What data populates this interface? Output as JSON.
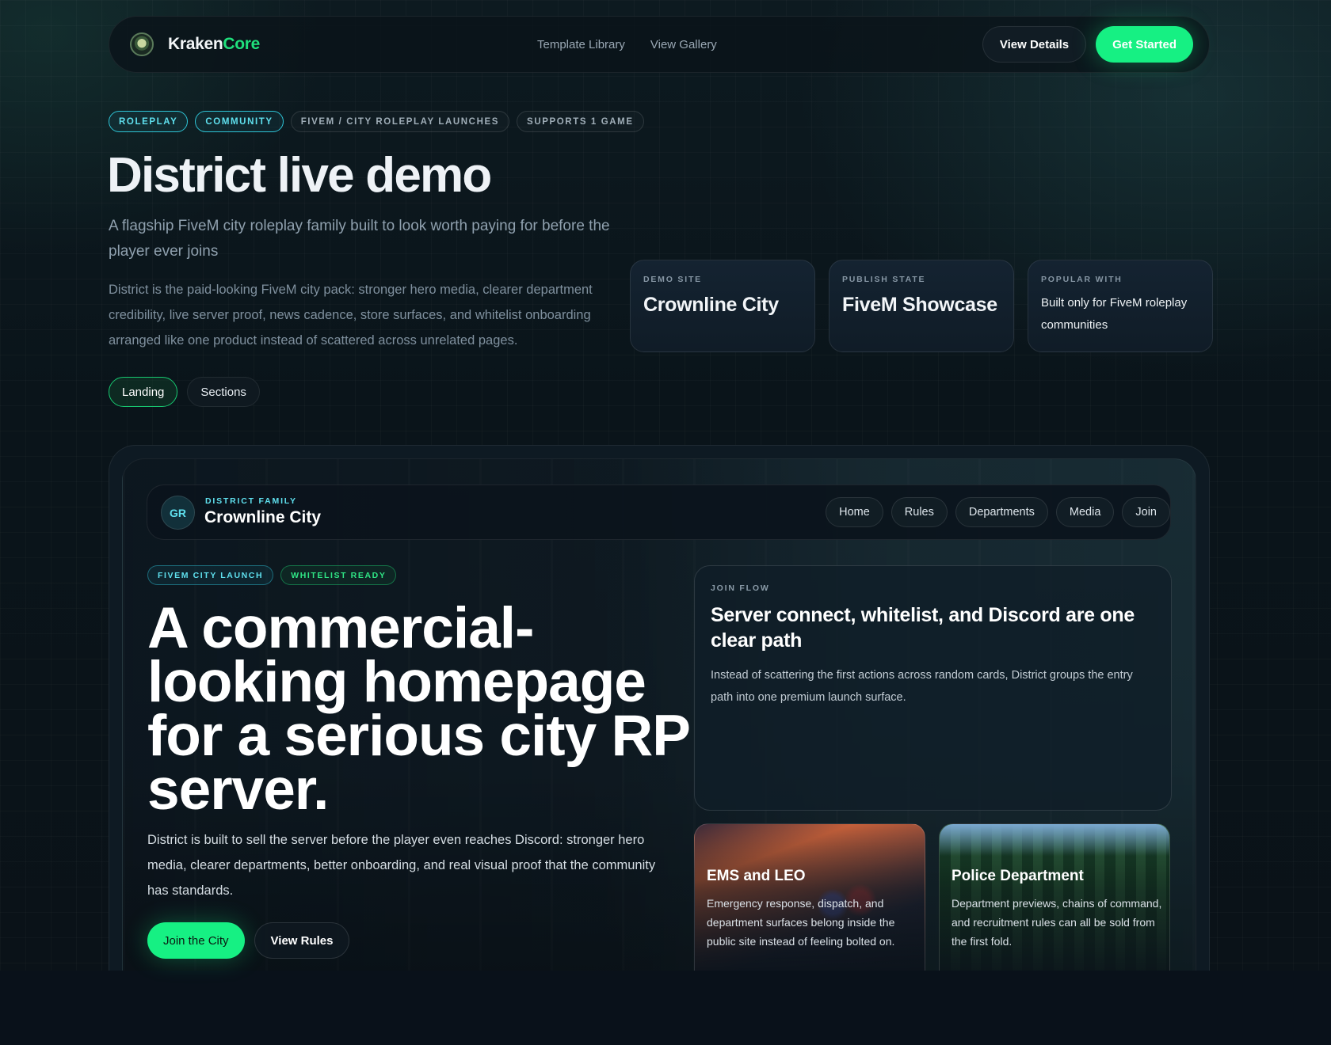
{
  "brand": {
    "name_a": "Kraken",
    "name_b": "Core"
  },
  "topnav": {
    "links": [
      "Template Library",
      "View Gallery"
    ],
    "view_details": "View Details",
    "get_started": "Get Started"
  },
  "badges": [
    "ROLEPLAY",
    "COMMUNITY",
    "FIVEM / CITY ROLEPLAY LAUNCHES",
    "SUPPORTS 1 GAME"
  ],
  "hero": {
    "title": "District live demo",
    "subtitle": "A flagship FiveM city roleplay family built to look worth paying for before the player ever joins",
    "description": "District is the paid-looking FiveM city pack: stronger hero media, clearer department credibility, live server proof, news cadence, store surfaces, and whitelist onboarding arranged like one product instead of scattered across unrelated pages."
  },
  "view_tabs": [
    "Landing",
    "Sections"
  ],
  "stats": [
    {
      "label": "DEMO SITE",
      "value": "Crownline City"
    },
    {
      "label": "PUBLISH STATE",
      "value": "FiveM Showcase"
    },
    {
      "label": "POPULAR WITH",
      "value": "Built only for FiveM roleplay communities"
    }
  ],
  "demo": {
    "avatar": "GR",
    "family_label": "DISTRICT FAMILY",
    "city_name": "Crownline City",
    "nav": [
      "Home",
      "Rules",
      "Departments",
      "Media",
      "Join"
    ],
    "badges": [
      "FIVEM CITY LAUNCH",
      "WHITELIST READY"
    ],
    "title": "A commercial-looking homepage for a serious city RP server.",
    "description": "District is built to sell the server before the player even reaches Discord: stronger hero media, clearer departments, better onboarding, and real visual proof that the community has standards.",
    "join_button": "Join the City",
    "rules_button": "View Rules",
    "join_flow": {
      "label": "JOIN FLOW",
      "title": "Server connect, whitelist, and Discord are one clear path",
      "description": "Instead of scattering the first actions across random cards, District groups the entry path into one premium launch surface."
    },
    "cards": [
      {
        "title": "EMS and LEO",
        "description": "Emergency response, dispatch, and department surfaces belong inside the public site instead of feeling bolted on."
      },
      {
        "title": "Police Department",
        "description": "Department previews, chains of command, and recruitment rules can all be sold from the first fold."
      }
    ]
  },
  "colors": {
    "accent_green": "#16f083",
    "accent_cyan": "#5fe0ee",
    "background": "#0a1219"
  }
}
